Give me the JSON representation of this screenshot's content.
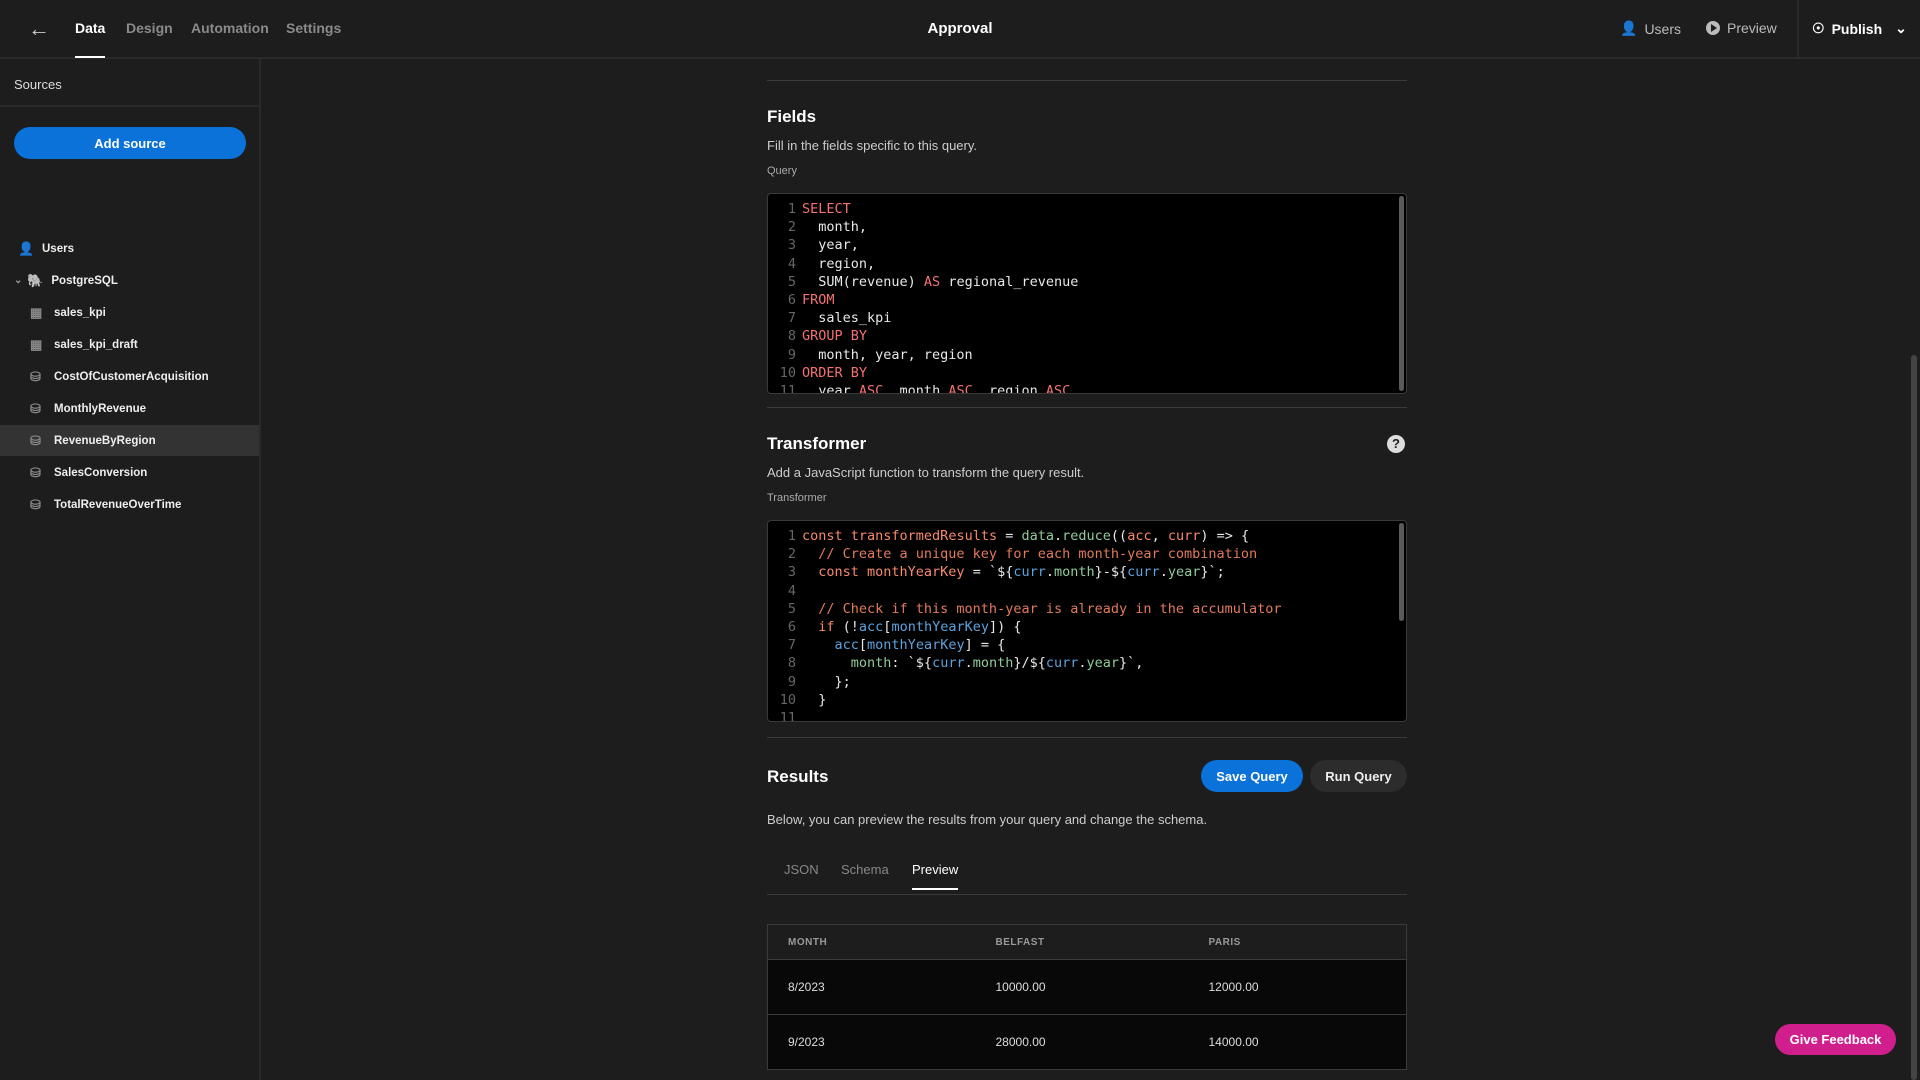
{
  "topbar": {
    "tabs": [
      "Data",
      "Design",
      "Automation",
      "Settings"
    ],
    "active_tab": "Data",
    "title": "Approval",
    "users": "Users",
    "preview": "Preview",
    "publish": "Publish"
  },
  "sidebar": {
    "heading": "Sources",
    "add_source": "Add source",
    "items": [
      {
        "label": "Users",
        "icon": "users-icon"
      },
      {
        "label": "PostgreSQL",
        "icon": "postgresql-icon"
      },
      {
        "label": "sales_kpi",
        "icon": "table-icon"
      },
      {
        "label": "sales_kpi_draft",
        "icon": "table-icon"
      },
      {
        "label": "CostOfCustomerAcquisition",
        "icon": "query-icon"
      },
      {
        "label": "MonthlyRevenue",
        "icon": "query-icon"
      },
      {
        "label": "RevenueByRegion",
        "icon": "query-icon",
        "selected": true
      },
      {
        "label": "SalesConversion",
        "icon": "query-icon"
      },
      {
        "label": "TotalRevenueOverTime",
        "icon": "query-icon"
      }
    ]
  },
  "fields": {
    "title": "Fields",
    "description": "Fill in the fields specific to this query.",
    "query_label": "Query",
    "query_lines": [
      [
        [
          "SELECT",
          "kw"
        ]
      ],
      [
        [
          "  month,",
          "pl"
        ]
      ],
      [
        [
          "  year,",
          "pl"
        ]
      ],
      [
        [
          "  region,",
          "pl"
        ]
      ],
      [
        [
          "  SUM(revenue) ",
          "pl"
        ],
        [
          "AS",
          "kw"
        ],
        [
          " regional_revenue",
          "pl"
        ]
      ],
      [
        [
          "FROM",
          "kw"
        ]
      ],
      [
        [
          "  sales_kpi",
          "pl"
        ]
      ],
      [
        [
          "GROUP BY",
          "kw"
        ]
      ],
      [
        [
          "  month, year, region",
          "pl"
        ]
      ],
      [
        [
          "ORDER BY",
          "kw"
        ]
      ],
      [
        [
          "  year ",
          "pl"
        ],
        [
          "ASC",
          "kw"
        ],
        [
          ", month ",
          "pl"
        ],
        [
          "ASC",
          "kw"
        ],
        [
          ", region ",
          "pl"
        ],
        [
          "ASC",
          "kw"
        ]
      ]
    ]
  },
  "transformer": {
    "title": "Transformer",
    "description": "Add a JavaScript function to transform the query result.",
    "label": "Transformer",
    "lines": [
      [
        [
          "const ",
          "cst"
        ],
        [
          "transformedResults",
          "cst"
        ],
        [
          " = ",
          "pl"
        ],
        [
          "data",
          "fn"
        ],
        [
          ".",
          "pl"
        ],
        [
          "reduce",
          "fn"
        ],
        [
          "((",
          "pl"
        ],
        [
          "acc",
          "cst"
        ],
        [
          ", ",
          "pl"
        ],
        [
          "curr",
          "cst"
        ],
        [
          ") => {",
          "pl"
        ]
      ],
      [
        [
          "  // Create a unique key for each month-year combination",
          "cm"
        ]
      ],
      [
        [
          "  const ",
          "cst"
        ],
        [
          "monthYearKey",
          "cst"
        ],
        [
          " = `${",
          "pl"
        ],
        [
          "curr",
          "var"
        ],
        [
          ".",
          "pl"
        ],
        [
          "month",
          "fn"
        ],
        [
          "}-${",
          "pl"
        ],
        [
          "curr",
          "var"
        ],
        [
          ".",
          "pl"
        ],
        [
          "year",
          "fn"
        ],
        [
          "}`;",
          "pl"
        ]
      ],
      [
        [
          "",
          "pl"
        ]
      ],
      [
        [
          "  // Check if this month-year is already in the accumulator",
          "cm"
        ]
      ],
      [
        [
          "  if ",
          "cst"
        ],
        [
          "(!",
          "pl"
        ],
        [
          "acc",
          "var"
        ],
        [
          "[",
          "pl"
        ],
        [
          "monthYearKey",
          "var"
        ],
        [
          "]) {",
          "pl"
        ]
      ],
      [
        [
          "    ",
          "pl"
        ],
        [
          "acc",
          "var"
        ],
        [
          "[",
          "pl"
        ],
        [
          "monthYearKey",
          "var"
        ],
        [
          "] = {",
          "pl"
        ]
      ],
      [
        [
          "      ",
          "pl"
        ],
        [
          "month",
          "fn"
        ],
        [
          ": `${",
          "pl"
        ],
        [
          "curr",
          "var"
        ],
        [
          ".",
          "pl"
        ],
        [
          "month",
          "fn"
        ],
        [
          "}/${",
          "pl"
        ],
        [
          "curr",
          "var"
        ],
        [
          ".",
          "pl"
        ],
        [
          "year",
          "fn"
        ],
        [
          "}`,",
          "pl"
        ]
      ],
      [
        [
          "    };",
          "pl"
        ]
      ],
      [
        [
          "  }",
          "pl"
        ]
      ],
      [
        [
          "",
          "pl"
        ]
      ]
    ]
  },
  "results": {
    "title": "Results",
    "save": "Save Query",
    "run": "Run Query",
    "description": "Below, you can preview the results from your query and change the schema.",
    "tabs": [
      "JSON",
      "Schema",
      "Preview"
    ],
    "active_tab": "Preview",
    "columns": [
      "MONTH",
      "BELFAST",
      "PARIS"
    ],
    "rows": [
      [
        "8/2023",
        "10000.00",
        "12000.00"
      ],
      [
        "9/2023",
        "28000.00",
        "14000.00"
      ]
    ]
  },
  "feedback": "Give Feedback",
  "colors": {
    "accent": "#0a72d9",
    "feedback": "#d01f8c",
    "keyword": "#f57272"
  }
}
